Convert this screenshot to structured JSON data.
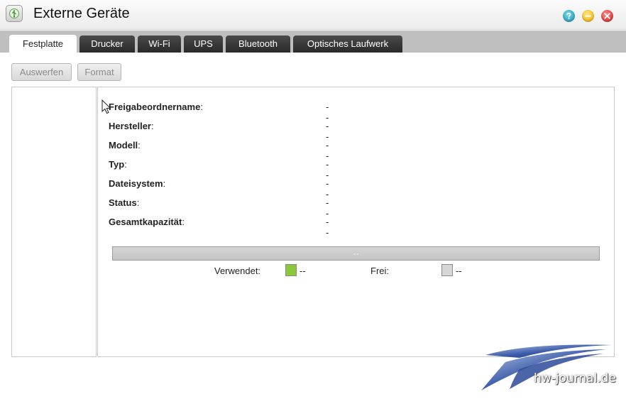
{
  "window": {
    "title": "Externe Geräte",
    "icon": "usb-drive-icon",
    "controls": [
      "help-icon",
      "minimize-icon",
      "close-icon"
    ]
  },
  "tabs": [
    {
      "label": "Festplatte",
      "active": true
    },
    {
      "label": "Drucker",
      "active": false
    },
    {
      "label": "Wi-Fi",
      "active": false
    },
    {
      "label": "UPS",
      "active": false
    },
    {
      "label": "Bluetooth",
      "active": false
    },
    {
      "label": "Optisches Laufwerk",
      "active": false
    }
  ],
  "toolbar": {
    "eject_label": "Auswerfen",
    "format_label": "Format"
  },
  "details": [
    {
      "label": "Freigabeordnername",
      "colon": ":",
      "value": "--"
    },
    {
      "label": "Hersteller",
      "colon": ":",
      "value": "--"
    },
    {
      "label": "Modell",
      "colon": ":",
      "value": "--"
    },
    {
      "label": "Typ",
      "colon": ":",
      "value": "--"
    },
    {
      "label": "Dateisystem",
      "colon": ":",
      "value": "--"
    },
    {
      "label": "Status",
      "colon": ":",
      "value": "--"
    },
    {
      "label": "Gesamtkapazität",
      "colon": ":",
      "value": "--"
    }
  ],
  "usage": {
    "bar_text": "--",
    "used_fraction": 0,
    "used_label": "Verwendet:",
    "used_value": "--",
    "used_color": "#8bc93a",
    "free_label": "Frei:",
    "free_value": "--",
    "free_color": "#d6d6d6"
  },
  "watermark": {
    "text": "hw-journal.de"
  }
}
